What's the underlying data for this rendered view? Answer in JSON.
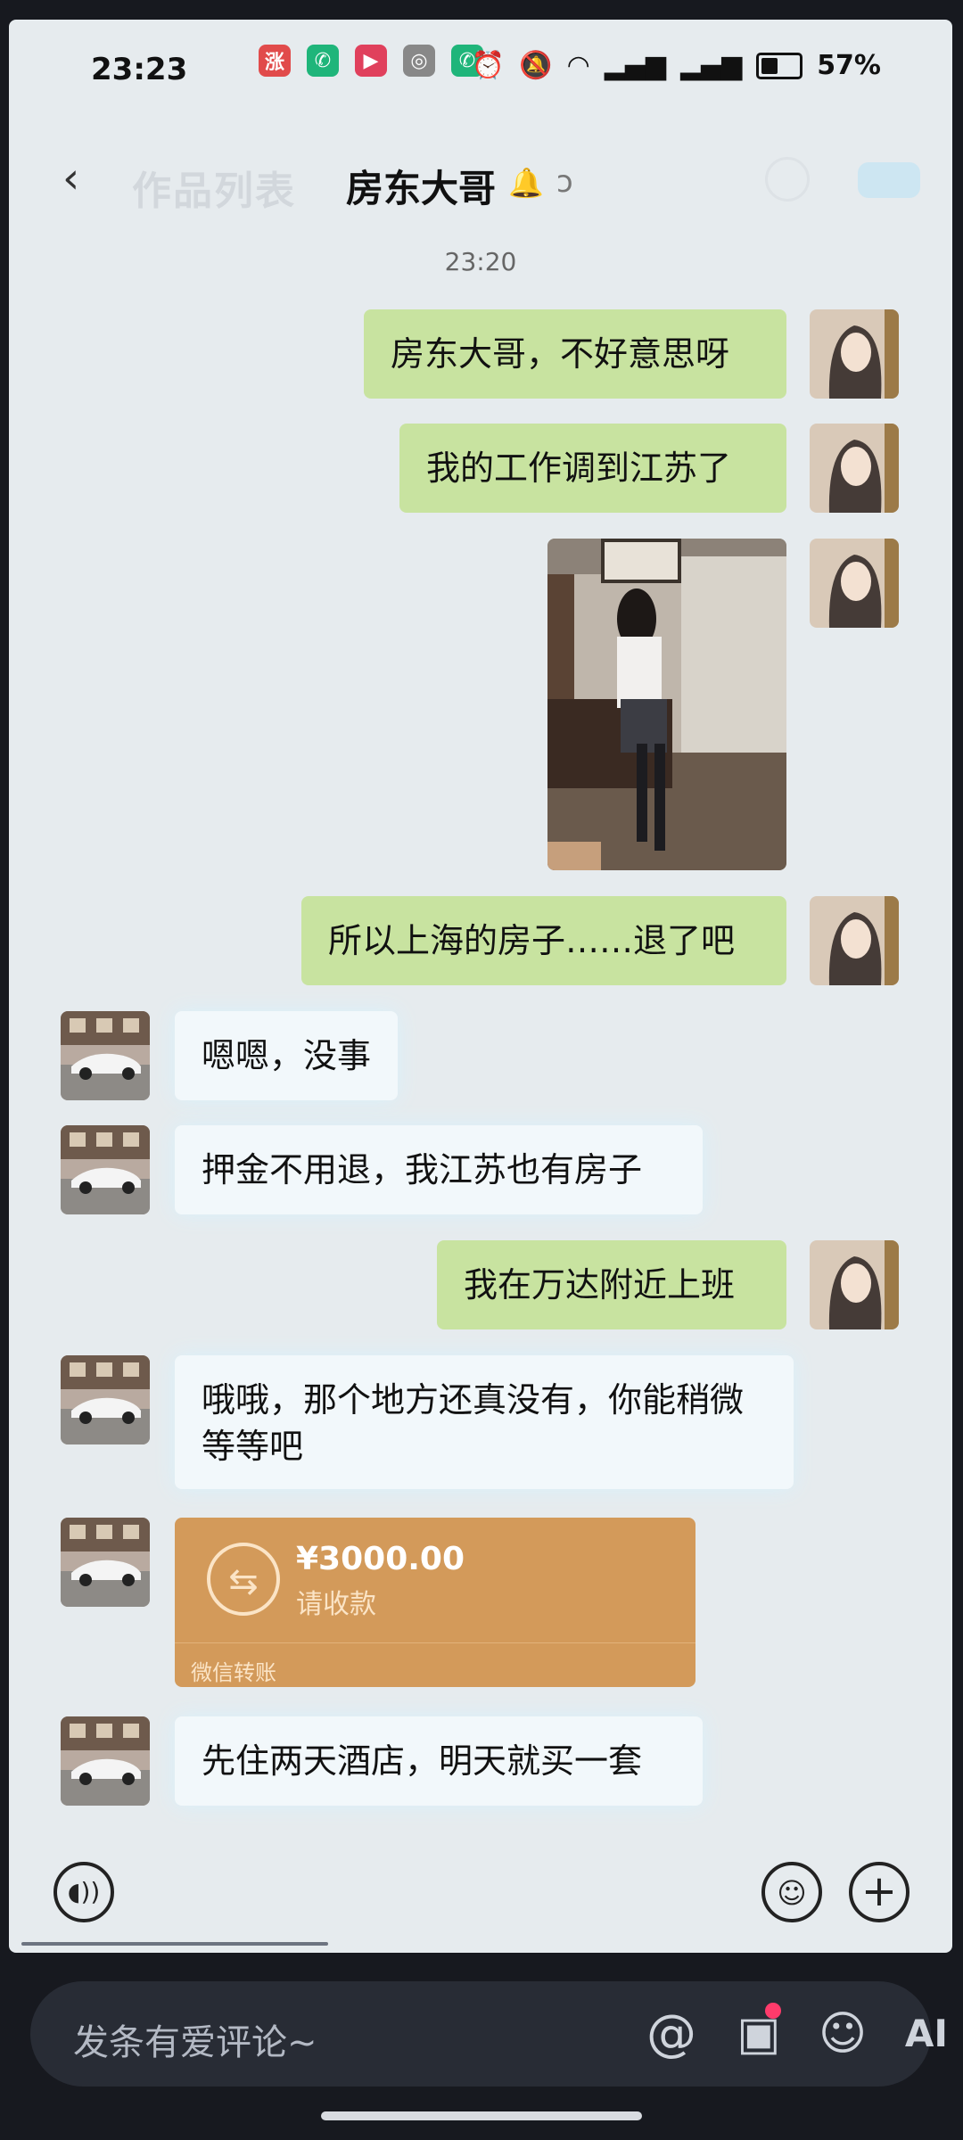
{
  "status_bar": {
    "time": "23:23",
    "app_icons": [
      {
        "name": "red-app-icon",
        "glyph": "涨",
        "color": "#e14b4b"
      },
      {
        "name": "phone-icon",
        "glyph": "✆",
        "color": "#1fb57a"
      },
      {
        "name": "play-icon",
        "glyph": "▶",
        "color": "#e0405c"
      },
      {
        "name": "unicom-icon",
        "glyph": "◎",
        "color": "#888888"
      },
      {
        "name": "phone-icon",
        "glyph": "✆",
        "color": "#1fb57a"
      }
    ],
    "battery": "57%"
  },
  "header": {
    "back_icon": "‹",
    "ghost_title": "作品列表",
    "title": "房东大哥"
  },
  "timestamp": "23:20",
  "messages": [
    {
      "side": "me",
      "type": "text",
      "text": "房东大哥，不好意思呀"
    },
    {
      "side": "me",
      "type": "text",
      "text": "我的工作调到江苏了"
    },
    {
      "side": "me",
      "type": "image",
      "text": ""
    },
    {
      "side": "me",
      "type": "text",
      "text": "所以上海的房子……退了吧"
    },
    {
      "side": "other",
      "type": "text",
      "text": "嗯嗯，没事"
    },
    {
      "side": "other",
      "type": "text",
      "text": "押金不用退，我江苏也有房子"
    },
    {
      "side": "me",
      "type": "text",
      "text": "我在万达附近上班"
    },
    {
      "side": "other",
      "type": "text",
      "text": "哦哦，那个地方还真没有，你能稍微等等吧"
    },
    {
      "side": "other",
      "type": "transfer",
      "amount": "¥3000.00",
      "subtitle": "请收款",
      "footer": "微信转账"
    },
    {
      "side": "other",
      "type": "text",
      "text": "先住两天酒店，明天就买一套"
    }
  ],
  "input_bar": {
    "voice_icon": "voice-icon",
    "emoji_icon": "emoji-icon",
    "plus_icon": "plus-icon"
  },
  "comment_bar": {
    "placeholder": "发条有爱评论~",
    "at_icon": "@",
    "ai_icon": "AI"
  },
  "colors": {
    "my_bubble": "#c8e3a0",
    "other_bubble": "#f2f8fb",
    "transfer": "#d39a5a"
  }
}
